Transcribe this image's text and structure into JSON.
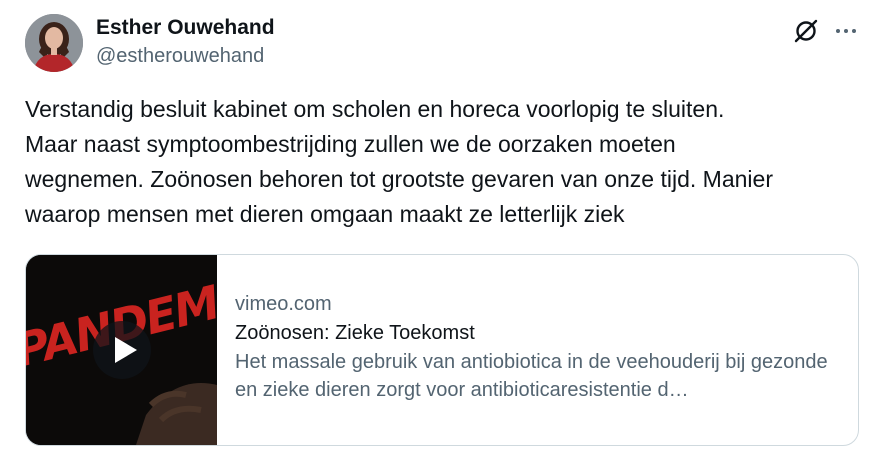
{
  "tweet": {
    "author": {
      "name": "Esther Ouwehand",
      "handle": "@estherouwehand"
    },
    "icons": {
      "grok": "grok-slash-circle-icon",
      "more": "more-ellipsis-icon"
    },
    "text": "Verstandig besluit kabinet om scholen en horeca voorlopig te sluiten.\nMaar naast symptoombestrijding zullen we de oorzaken moeten\nwegnemen. Zoönosen behoren tot grootste gevaren van onze tijd. Manier\nwaarop mensen met dieren omgaan maakt ze letterlijk ziek",
    "card": {
      "thumbnail_lettering": "PANDEMIE",
      "domain": "vimeo.com",
      "title": "Zoönosen: Zieke Toekomst",
      "description": "Het massale gebruik van antiobiotica in de veehouderij bij gezonde en zieke dieren zorgt voor antibioticaresistentie d…"
    }
  },
  "colors": {
    "text_primary": "#0f1419",
    "text_secondary": "#536471",
    "border": "#cfd9de",
    "thumbnail_red": "#c9231f"
  }
}
